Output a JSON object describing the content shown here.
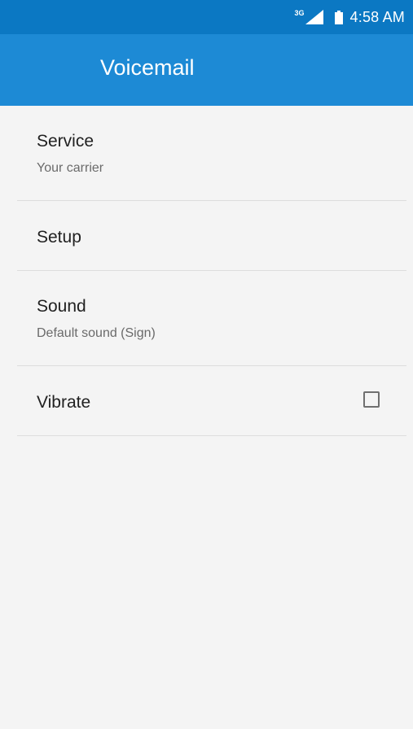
{
  "status_bar": {
    "network_type": "3G",
    "signal_icon": "signal-strength-icon",
    "battery_icon": "battery-icon",
    "time": "4:58 AM"
  },
  "app_bar": {
    "title": "Voicemail"
  },
  "settings": [
    {
      "title": "Service",
      "summary": "Your carrier"
    },
    {
      "title": "Setup"
    },
    {
      "title": "Sound",
      "summary": "Default sound (Sign)"
    },
    {
      "title": "Vibrate",
      "control": "checkbox",
      "checked": false
    }
  ],
  "colors": {
    "status_bar_bg": "#0b78c3",
    "app_bar_bg": "#1d8ad5",
    "page_bg": "#f4f4f4",
    "title_text": "#212121",
    "summary_text": "#6a6a6a",
    "divider": "#dddddd"
  }
}
